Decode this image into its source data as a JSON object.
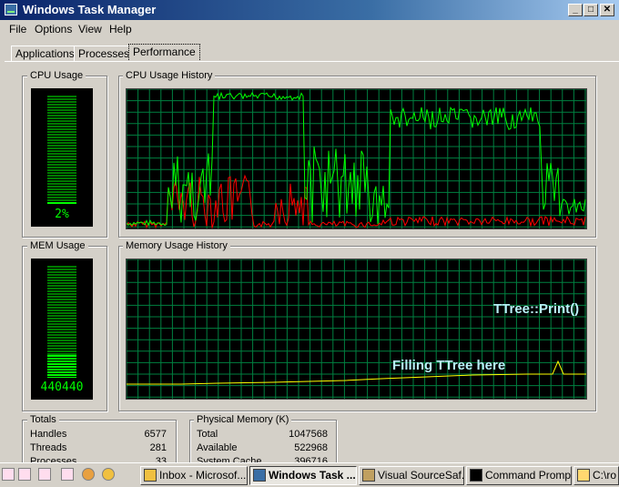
{
  "window": {
    "title": "Windows Task Manager",
    "min": "_",
    "max": "□",
    "close": "✕"
  },
  "menu": [
    "File",
    "Options",
    "View",
    "Help"
  ],
  "tabs": [
    "Applications",
    "Processes",
    "Performance"
  ],
  "cpu": {
    "label": "CPU Usage",
    "value": "2%",
    "level": 0.02,
    "history_label": "CPU Usage History"
  },
  "mem": {
    "label": "MEM Usage",
    "value": "440440",
    "level": 0.2,
    "history_label": "Memory Usage History"
  },
  "annotations": {
    "print": "TTree::Print()",
    "filling": "Filling TTree here"
  },
  "totals": {
    "label": "Totals",
    "rows": [
      {
        "name": "Handles",
        "value": "6577"
      },
      {
        "name": "Threads",
        "value": "281"
      },
      {
        "name": "Processes",
        "value": "33"
      }
    ]
  },
  "physical": {
    "label": "Physical Memory (K)",
    "rows": [
      {
        "name": "Total",
        "value": "1047568"
      },
      {
        "name": "Available",
        "value": "522968"
      },
      {
        "name": "System Cache",
        "value": "396716"
      }
    ]
  },
  "taskbar": {
    "buttons": [
      {
        "label": "Inbox - Microsof...",
        "icon": "outlook-icon"
      },
      {
        "label": "Windows Task ...",
        "icon": "task-manager-icon",
        "active": true
      },
      {
        "label": "Visual SourceSaf...",
        "icon": "sourcesafe-icon"
      },
      {
        "label": "Command Prompt",
        "icon": "cmd-icon"
      },
      {
        "label": "C:\\ro",
        "icon": "explorer-icon"
      }
    ]
  },
  "colors": {
    "graph_green": "#00ff00",
    "graph_red": "#ff0000",
    "grid": "#008040",
    "mem_line": "#ffff00",
    "annotation": "#b8f0f8"
  }
}
